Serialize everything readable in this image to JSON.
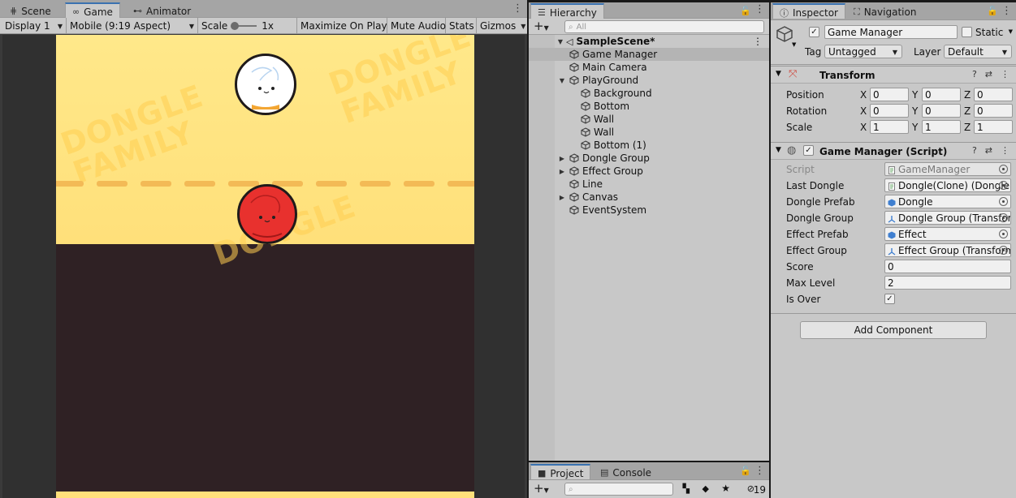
{
  "game_panel": {
    "tabs": [
      {
        "label": "Scene",
        "icon": "grid-icon"
      },
      {
        "label": "Game",
        "icon": "gamepad-icon"
      },
      {
        "label": "Animator",
        "icon": "animator-icon"
      }
    ],
    "toolbar": {
      "display": "Display 1",
      "aspect": "Mobile (9:19 Aspect)",
      "scale_label": "Scale",
      "scale_value": "1x",
      "maximize": "Maximize On Play",
      "mute": "Mute Audio",
      "stats": "Stats",
      "gizmos": "Gizmos"
    },
    "watermark": [
      "DONGLE",
      "FAMILY",
      "DONGLE",
      "FAMILY",
      "DONGLE"
    ],
    "colors": {
      "sky": "#ffe88a",
      "ground": "#2f2124",
      "dash": "#f3ba56",
      "white_dongle": "#ffffff",
      "red_dongle": "#e8312e"
    }
  },
  "hierarchy": {
    "tab_label": "Hierarchy",
    "search_placeholder": "All",
    "scene_name": "SampleScene*",
    "items": [
      {
        "label": "Game Manager",
        "depth": 1,
        "expandable": false,
        "selected": true
      },
      {
        "label": "Main Camera",
        "depth": 1,
        "expandable": false,
        "selected": false
      },
      {
        "label": "PlayGround",
        "depth": 1,
        "expandable": true,
        "expanded": true,
        "selected": false
      },
      {
        "label": "Background",
        "depth": 2,
        "expandable": false,
        "selected": false
      },
      {
        "label": "Bottom",
        "depth": 2,
        "expandable": false,
        "selected": false
      },
      {
        "label": "Wall",
        "depth": 2,
        "expandable": false,
        "selected": false
      },
      {
        "label": "Wall",
        "depth": 2,
        "expandable": false,
        "selected": false
      },
      {
        "label": "Bottom (1)",
        "depth": 2,
        "expandable": false,
        "selected": false
      },
      {
        "label": "Dongle Group",
        "depth": 1,
        "expandable": true,
        "expanded": false,
        "selected": false
      },
      {
        "label": "Effect Group",
        "depth": 1,
        "expandable": true,
        "expanded": false,
        "selected": false
      },
      {
        "label": "Line",
        "depth": 1,
        "expandable": false,
        "selected": false
      },
      {
        "label": "Canvas",
        "depth": 1,
        "expandable": true,
        "expanded": false,
        "selected": false
      },
      {
        "label": "EventSystem",
        "depth": 1,
        "expandable": false,
        "selected": false
      }
    ]
  },
  "project": {
    "tabs": [
      {
        "label": "Project"
      },
      {
        "label": "Console"
      }
    ],
    "hidden_count": "19"
  },
  "inspector": {
    "tabs": [
      {
        "label": "Inspector"
      },
      {
        "label": "Navigation"
      }
    ],
    "object_name": "Game Manager",
    "active": true,
    "static_label": "Static",
    "tag_label": "Tag",
    "tag_value": "Untagged",
    "layer_label": "Layer",
    "layer_value": "Default",
    "transform": {
      "title": "Transform",
      "rows": [
        {
          "label": "Position",
          "x": "0",
          "y": "0",
          "z": "0"
        },
        {
          "label": "Rotation",
          "x": "0",
          "y": "0",
          "z": "0"
        },
        {
          "label": "Scale",
          "x": "1",
          "y": "1",
          "z": "1"
        }
      ]
    },
    "script_component": {
      "title": "Game Manager (Script)",
      "enabled": true,
      "fields": [
        {
          "label": "Script",
          "value": "GameManager",
          "kind": "script",
          "disabled": true
        },
        {
          "label": "Last Dongle",
          "value": "Dongle(Clone) (Dongle)",
          "kind": "script"
        },
        {
          "label": "Dongle Prefab",
          "value": "Dongle",
          "kind": "prefab"
        },
        {
          "label": "Dongle Group",
          "value": "Dongle Group (Transform)",
          "kind": "transform"
        },
        {
          "label": "Effect Prefab",
          "value": "Effect",
          "kind": "prefab"
        },
        {
          "label": "Effect Group",
          "value": "Effect Group (Transform)",
          "kind": "transform"
        }
      ],
      "score_label": "Score",
      "score_value": "0",
      "max_level_label": "Max Level",
      "max_level_value": "2",
      "is_over_label": "Is Over",
      "is_over_value": true
    },
    "add_component": "Add Component"
  }
}
